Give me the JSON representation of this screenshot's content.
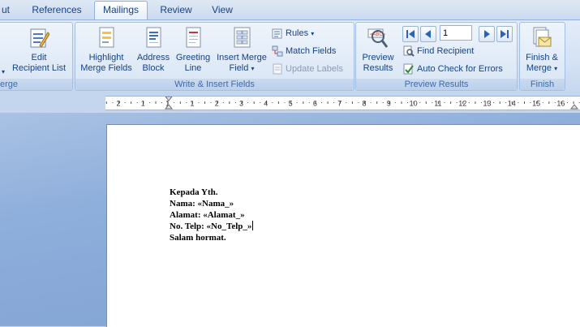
{
  "tabs": [
    {
      "label": "ut"
    },
    {
      "label": "References"
    },
    {
      "label": "Mailings"
    },
    {
      "label": "Review"
    },
    {
      "label": "View"
    }
  ],
  "ribbon": {
    "start_group": {
      "edit_recipient_label": "Edit\nRecipient List",
      "label_line1": "Edit",
      "label_line2": "Recipient List",
      "group_label": "erge"
    },
    "write_insert": {
      "group_label": "Write & Insert Fields",
      "highlight": {
        "line1": "Highlight",
        "line2": "Merge Fields"
      },
      "address": {
        "line1": "Address",
        "line2": "Block"
      },
      "greeting": {
        "line1": "Greeting",
        "line2": "Line"
      },
      "insert_field": {
        "line1": "Insert Merge",
        "line2": "Field"
      },
      "rules": "Rules",
      "match_fields": "Match Fields",
      "update_labels": "Update Labels"
    },
    "preview": {
      "group_label": "Preview Results",
      "preview_btn": {
        "line1": "Preview",
        "line2": "Results"
      },
      "record_value": "1",
      "find_recipient": "Find Recipient",
      "auto_check": "Auto Check for Errors"
    },
    "finish": {
      "group_label": "Finish",
      "finish_btn": {
        "line1": "Finish &",
        "line2": "Merge"
      }
    }
  },
  "ruler": {
    "labels": [
      "2",
      "1",
      "1",
      "1",
      "2",
      "3",
      "4",
      "5",
      "6",
      "7",
      "8",
      "9",
      "10",
      "11",
      "12",
      "13",
      "14",
      "15",
      "16"
    ]
  },
  "document": {
    "lines": [
      "Kepada Yth.",
      "Nama: «Nama_»",
      "Alamat: «Alamat_»",
      "No. Telp: «No_Telp_»",
      "Salam hormat."
    ]
  },
  "colors": {
    "ribbon_text": "#15428b",
    "group_label_text": "#3e6aaa",
    "workspace": "#8eaedb"
  }
}
